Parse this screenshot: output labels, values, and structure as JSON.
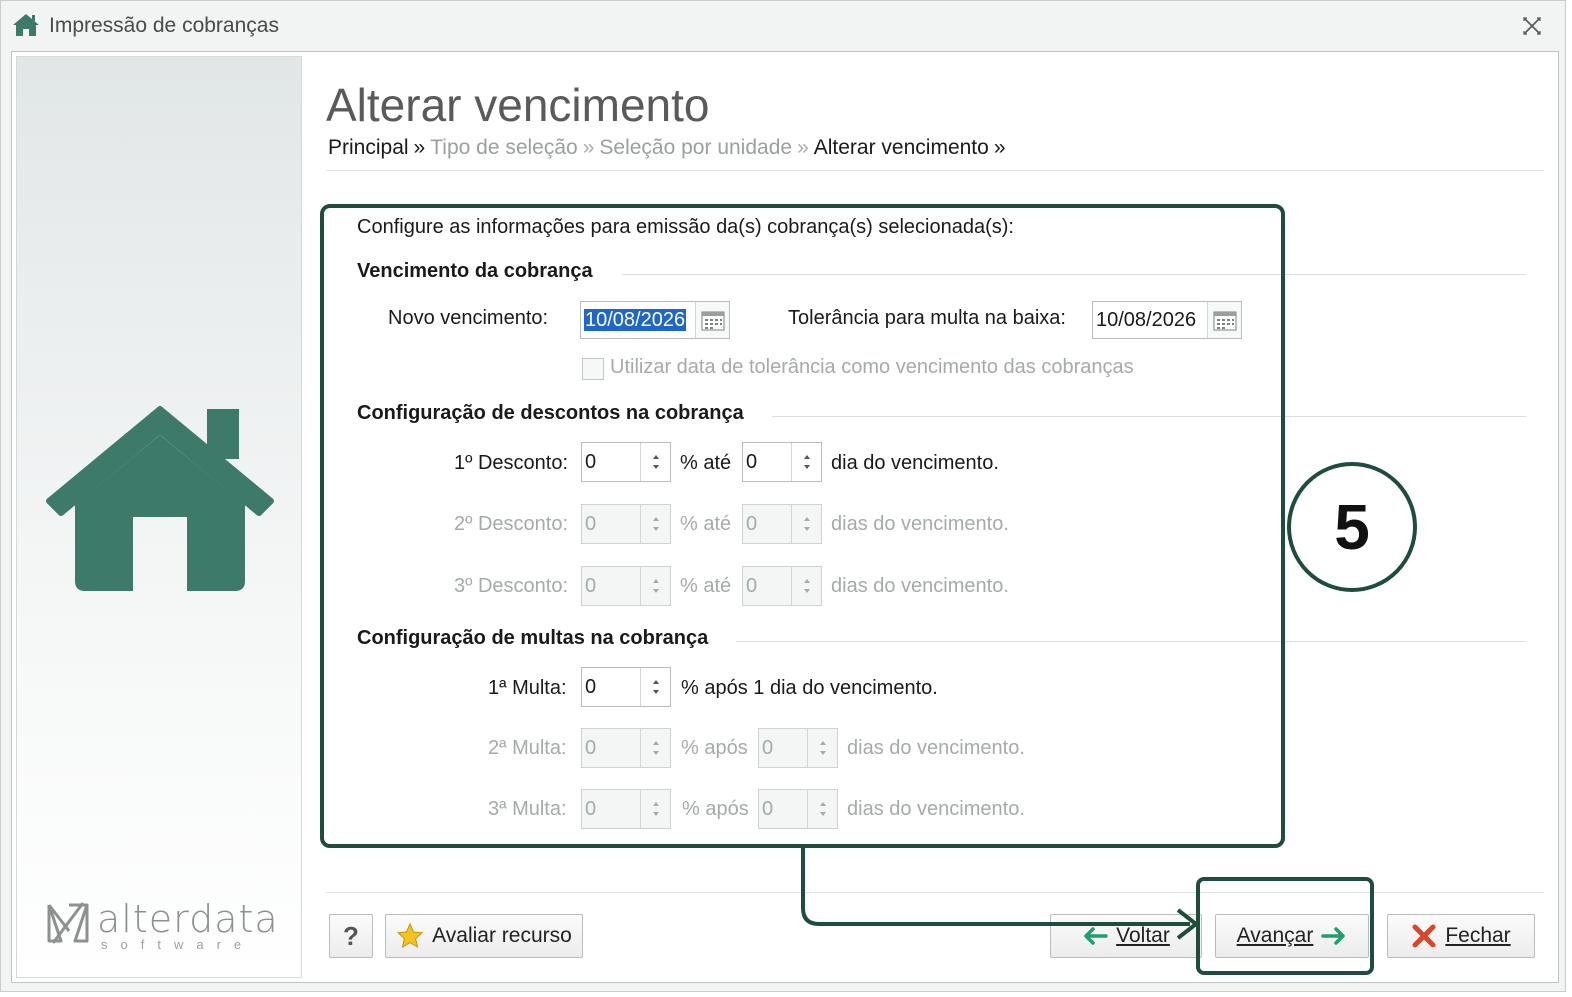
{
  "window": {
    "title": "Impressão de cobranças"
  },
  "page": {
    "title": "Alterar vencimento",
    "breadcrumb": [
      {
        "label": "Principal",
        "active": true
      },
      {
        "label": "Tipo de seleção",
        "active": false
      },
      {
        "label": "Seleção por unidade",
        "active": false
      },
      {
        "label": "Alterar vencimento",
        "active": true
      }
    ],
    "breadcrumb_sep": "»"
  },
  "form": {
    "intro": "Configure as informações para emissão da(s) cobrança(s) selecionada(s):",
    "vencimento": {
      "heading": "Vencimento da cobrança",
      "novo_label": "Novo vencimento:",
      "novo_value": "10/08/2026",
      "tolerancia_label": "Tolerância para multa na baixa:",
      "tolerancia_value": "10/08/2026",
      "usar_tolerancia_label": "Utilizar data de tolerância como vencimento das cobranças"
    },
    "descontos": {
      "heading": "Configuração de descontos na cobrança",
      "rows": [
        {
          "label": "1º Desconto:",
          "percent": "0",
          "mid": "% até",
          "days": "0",
          "suffix": "dia do vencimento."
        },
        {
          "label": "2º Desconto:",
          "percent": "0",
          "mid": "% até",
          "days": "0",
          "suffix": "dias do vencimento."
        },
        {
          "label": "3º Desconto:",
          "percent": "0",
          "mid": "% até",
          "days": "0",
          "suffix": "dias do vencimento."
        }
      ]
    },
    "multas": {
      "heading": "Configuração de multas na cobrança",
      "rows": [
        {
          "label": "1ª Multa:",
          "percent": "0",
          "suffix": "% após 1 dia do vencimento."
        },
        {
          "label": "2ª Multa:",
          "percent": "0",
          "mid": "% após",
          "days": "0",
          "suffix": "dias do vencimento."
        },
        {
          "label": "3ª Multa:",
          "percent": "0",
          "mid": "% após",
          "days": "0",
          "suffix": "dias do vencimento."
        }
      ]
    }
  },
  "buttons": {
    "help": "?",
    "avaliar": "Avaliar recurso",
    "voltar": "Voltar",
    "avancar": "Avançar",
    "fechar": "Fechar"
  },
  "sidebar": {
    "logo_text": "alterdata",
    "logo_sub": "software"
  },
  "annotation": {
    "step_number": "5"
  },
  "colors": {
    "accent_green": "#3d7a6a",
    "callout": "#1f4d3c",
    "selection": "#1e66cc",
    "close_red": "#d9472b"
  }
}
